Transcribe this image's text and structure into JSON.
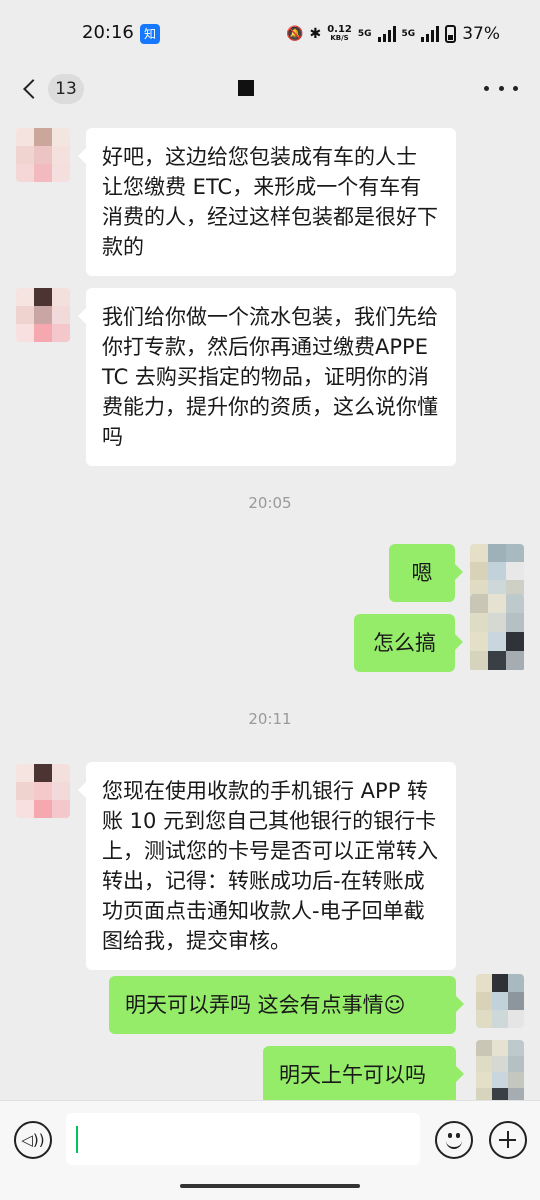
{
  "status_bar": {
    "time": "20:16",
    "app_icon_label": "知",
    "net_speed_value": "0.12",
    "net_speed_unit": "KB/S",
    "signal_1_label": "5G",
    "signal_2_label": "5G",
    "battery_percent": "37%"
  },
  "header": {
    "unread_count": "13",
    "icons": [
      "back-chevron",
      "more-dots"
    ]
  },
  "messages": [
    {
      "side": "left",
      "text": "好吧，这边给您包装成有车的人士  让您缴费 ETC，来形成一个有车有消费的人，经过这样包装都是很好下款的"
    },
    {
      "side": "left",
      "text": "我们给你做一个流水包装，我们先给你打专款，然后你再通过缴费APPETC 去购买指定的物品，证明你的消费能力，提升你的资质，这么说你懂吗"
    },
    {
      "side": "time",
      "text": "20:05"
    },
    {
      "side": "right",
      "text": "嗯"
    },
    {
      "side": "right",
      "text": "怎么搞"
    },
    {
      "side": "time",
      "text": "20:11"
    },
    {
      "side": "left",
      "text": "您现在使用收款的手机银行 APP 转账 10 元到您自己其他银行的银行卡上，测试您的卡号是否可以正常转入转出，记得：转账成功后-在转账成功页面点击通知收款人-电子回单截图给我，提交审核。"
    },
    {
      "side": "right",
      "text": "明天可以弄吗  这会有点事情☺"
    },
    {
      "side": "right",
      "text": "明天上午可以吗"
    }
  ],
  "colors": {
    "background": "#ededed",
    "sent_bubble": "#95ec69",
    "received_bubble": "#ffffff",
    "timestamp": "#9a9a9a",
    "caret": "#07c160"
  },
  "input_bar": {
    "value": "",
    "icons": [
      "voice-icon",
      "emoji-icon",
      "plus-icon"
    ]
  }
}
